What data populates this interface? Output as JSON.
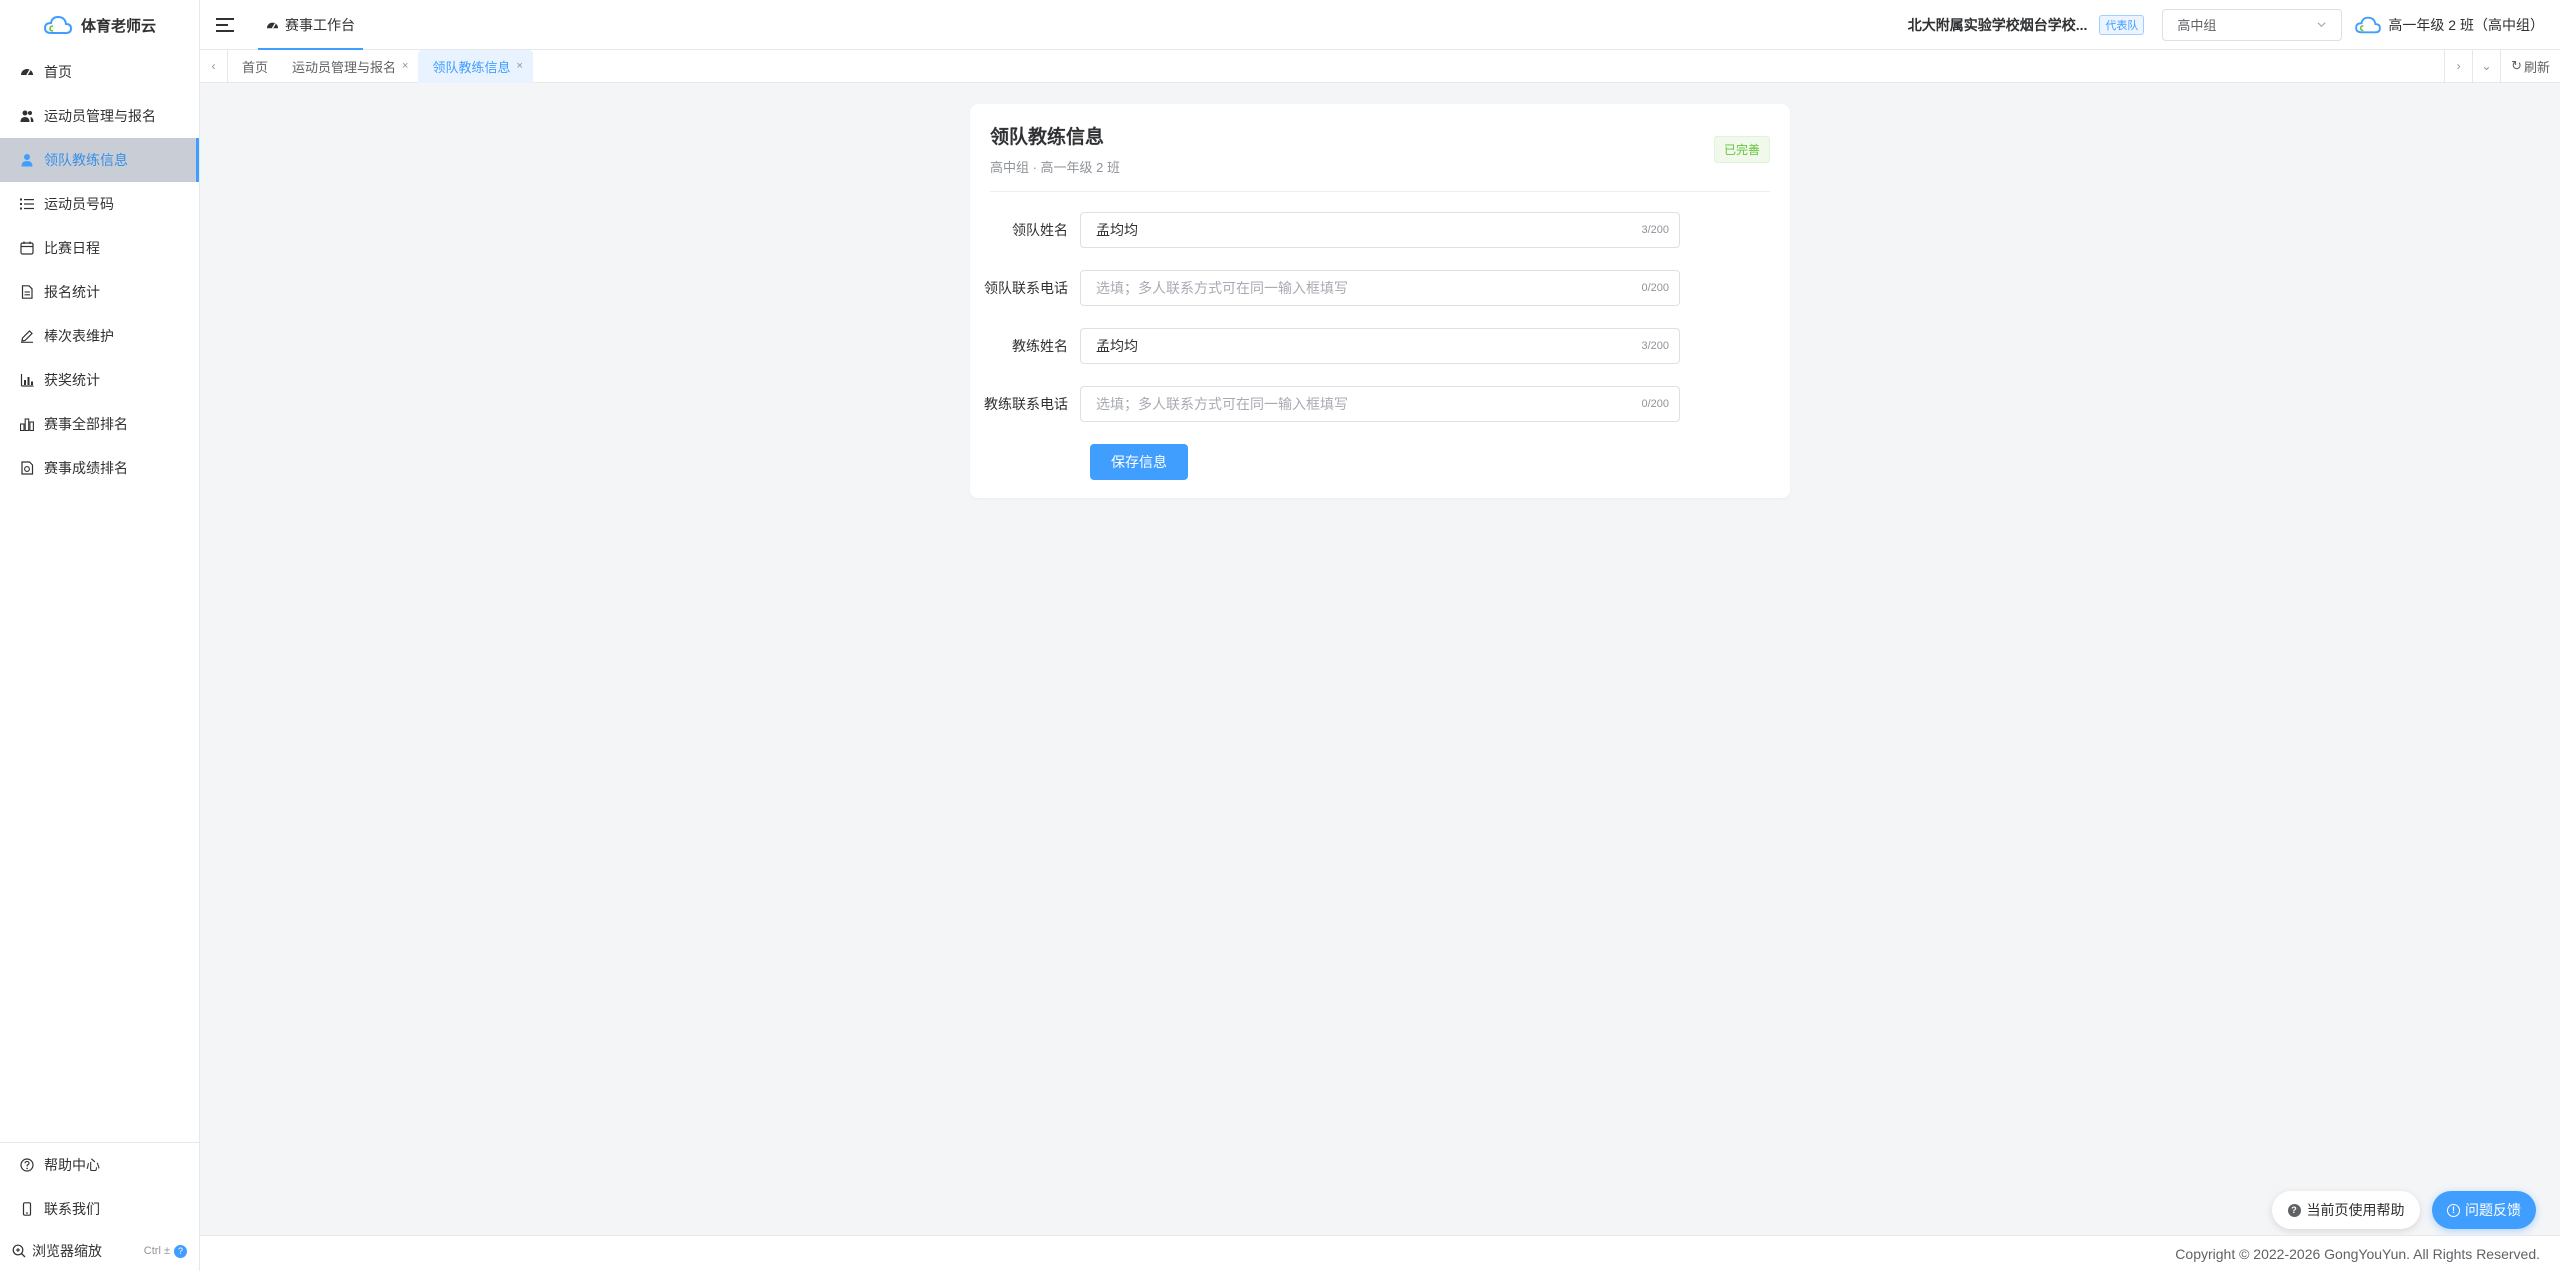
{
  "app": {
    "name": "体育老师云"
  },
  "sidebar": {
    "items": [
      {
        "label": "首页",
        "icon": "dashboard-icon"
      },
      {
        "label": "运动员管理与报名",
        "icon": "users-icon"
      },
      {
        "label": "领队教练信息",
        "icon": "user-icon",
        "active": true
      },
      {
        "label": "运动员号码",
        "icon": "list-icon"
      },
      {
        "label": "比赛日程",
        "icon": "calendar-icon"
      },
      {
        "label": "报名统计",
        "icon": "document-icon"
      },
      {
        "label": "棒次表维护",
        "icon": "edit-icon"
      },
      {
        "label": "获奖统计",
        "icon": "chart-icon"
      },
      {
        "label": "赛事全部排名",
        "icon": "ranking-icon"
      },
      {
        "label": "赛事成绩排名",
        "icon": "score-icon"
      }
    ],
    "bottom": {
      "help": "帮助中心",
      "contact": "联系我们",
      "zoom": "浏览器缩放",
      "zoom_hint": "Ctrl ±"
    }
  },
  "topbar": {
    "tab": "赛事工作台",
    "school": "北大附属实验学校烟台学校...",
    "badge": "代表队",
    "group_select": "高中组",
    "user": "高一年级 2 班（高中组）"
  },
  "tabs": {
    "items": [
      {
        "label": "首页",
        "closable": false,
        "active": false
      },
      {
        "label": "运动员管理与报名",
        "closable": true,
        "active": false
      },
      {
        "label": "领队教练信息",
        "closable": true,
        "active": true
      }
    ],
    "refresh": "刷新"
  },
  "card": {
    "title": "领队教练信息",
    "subtitle": "高中组 · 高一年级 2 班",
    "status": "已完善",
    "fields": {
      "leader_name": {
        "label": "领队姓名",
        "value": "孟均均",
        "count": "3/200"
      },
      "leader_phone": {
        "label": "领队联系电话",
        "value": "",
        "placeholder": "选填；多人联系方式可在同一输入框填写",
        "count": "0/200"
      },
      "coach_name": {
        "label": "教练姓名",
        "value": "孟均均",
        "count": "3/200"
      },
      "coach_phone": {
        "label": "教练联系电话",
        "value": "",
        "placeholder": "选填；多人联系方式可在同一输入框填写",
        "count": "0/200"
      }
    },
    "save_label": "保存信息"
  },
  "floating": {
    "help": "当前页使用帮助",
    "feedback": "问题反馈"
  },
  "footer": {
    "copyright": "Copyright © 2022-2026 GongYouYun. All Rights Reserved."
  },
  "colors": {
    "accent": "#409eff",
    "success": "#67c23a",
    "active_bg": "#c9ced6"
  }
}
